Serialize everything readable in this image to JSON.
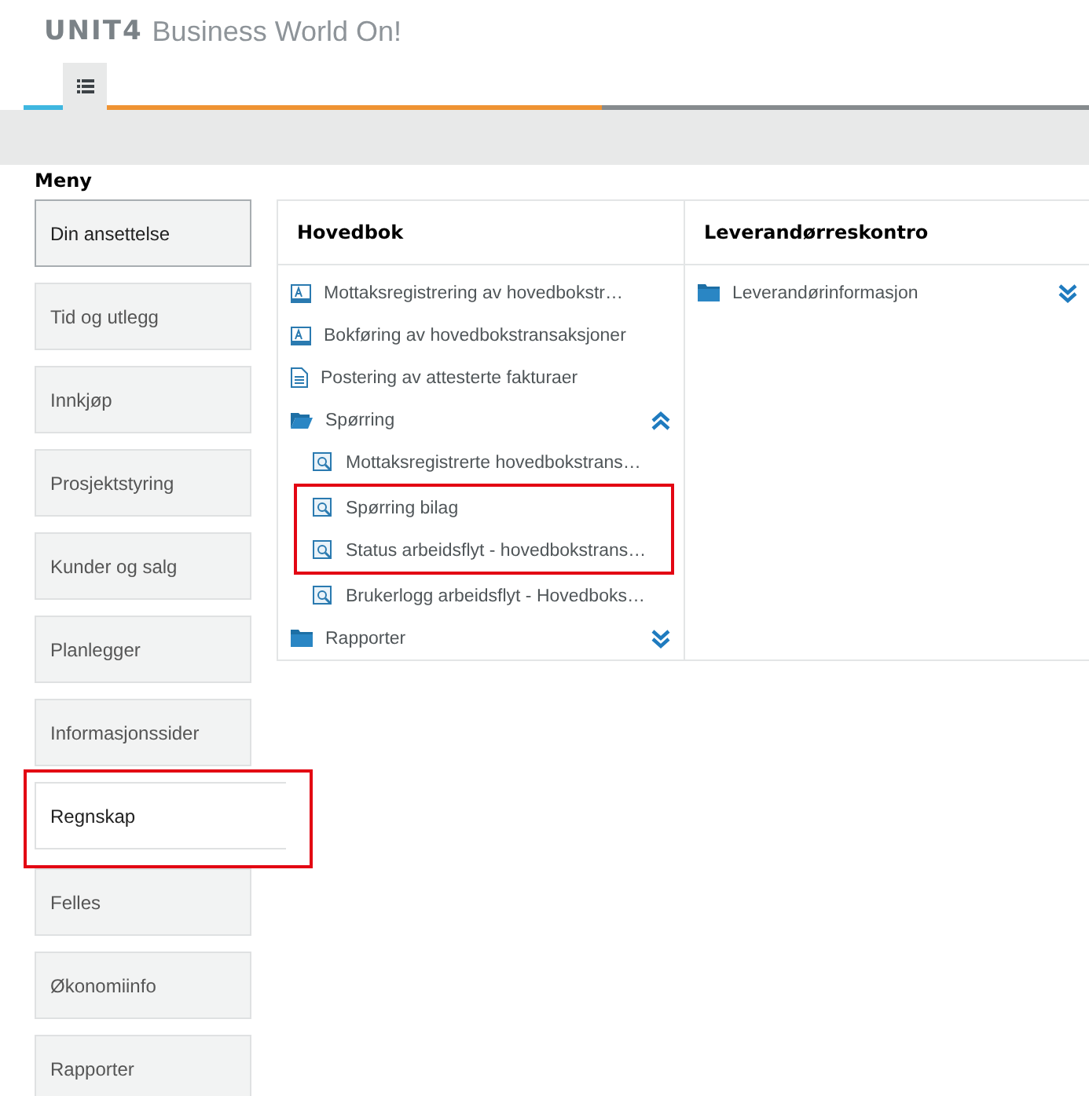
{
  "logo": {
    "mark": "UNIT4",
    "tagline": "Business World On!"
  },
  "menu": {
    "title": "Meny",
    "items": [
      {
        "label": "Din ansettelse",
        "selected": false,
        "focused": true,
        "highlighted": false
      },
      {
        "label": "Tid og utlegg",
        "selected": false,
        "focused": false,
        "highlighted": false
      },
      {
        "label": "Innkjøp",
        "selected": false,
        "focused": false,
        "highlighted": false
      },
      {
        "label": "Prosjektstyring",
        "selected": false,
        "focused": false,
        "highlighted": false
      },
      {
        "label": "Kunder og salg",
        "selected": false,
        "focused": false,
        "highlighted": false
      },
      {
        "label": "Planlegger",
        "selected": false,
        "focused": false,
        "highlighted": false
      },
      {
        "label": "Informasjonssider",
        "selected": false,
        "focused": false,
        "highlighted": false
      },
      {
        "label": "Regnskap",
        "selected": true,
        "focused": false,
        "highlighted": true
      },
      {
        "label": "Felles",
        "selected": false,
        "focused": false,
        "highlighted": false
      },
      {
        "label": "Økonomiinfo",
        "selected": false,
        "focused": false,
        "highlighted": false
      },
      {
        "label": "Rapporter",
        "selected": false,
        "focused": false,
        "highlighted": false
      }
    ]
  },
  "panels": [
    {
      "title": "Hovedbok",
      "items": [
        {
          "kind": "form",
          "label": "Mottaksregistrering av hovedbokstr…"
        },
        {
          "kind": "form",
          "label": "Bokføring av hovedbokstransaksjoner"
        },
        {
          "kind": "document",
          "label": "Postering av attesterte fakturaer"
        },
        {
          "kind": "folder",
          "label": "Spørring",
          "expanded": true,
          "children": [
            {
              "kind": "query",
              "label": "Mottaksregistrerte hovedbokstrans…",
              "highlighted": false
            },
            {
              "kind": "query",
              "label": "Spørring bilag",
              "highlighted": true
            },
            {
              "kind": "query",
              "label": "Status arbeidsflyt - hovedbokstrans…",
              "highlighted": true
            },
            {
              "kind": "query",
              "label": "Brukerlogg arbeidsflyt - Hovedboks…",
              "highlighted": false
            }
          ]
        },
        {
          "kind": "folder",
          "label": "Rapporter",
          "expanded": false
        }
      ]
    },
    {
      "title": "Leverandørreskontro",
      "items": [
        {
          "kind": "folder",
          "label": "Leverandørinformasjon",
          "expanded": false
        }
      ]
    }
  ]
}
